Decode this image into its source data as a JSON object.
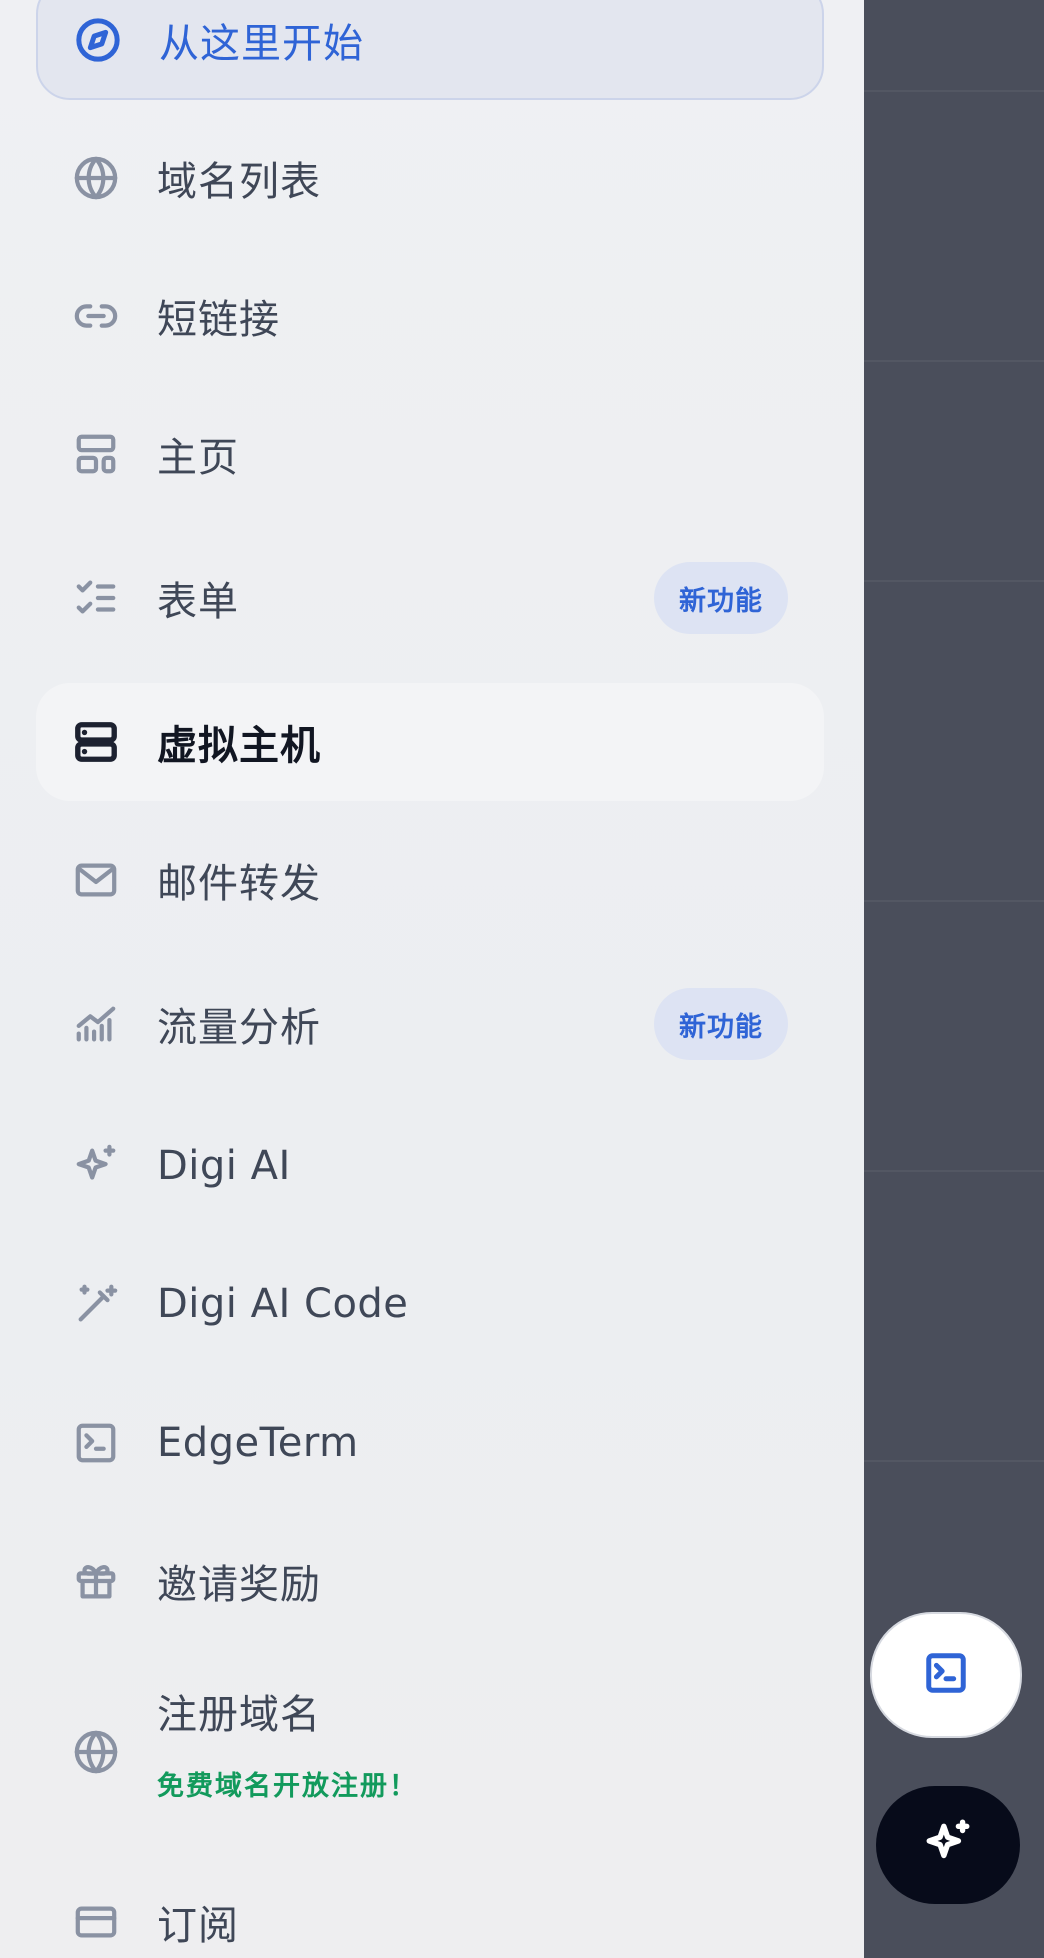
{
  "nav": {
    "start": {
      "label": "从这里开始",
      "icon": "compass-icon"
    },
    "domains": {
      "label": "域名列表",
      "icon": "globe-icon"
    },
    "short_links": {
      "label": "短链接",
      "icon": "link-icon"
    },
    "homepage": {
      "label": "主页",
      "icon": "layout-icon"
    },
    "forms": {
      "label": "表单",
      "icon": "list-checks-icon",
      "badge": "新功能"
    },
    "virtual_host": {
      "label": "虚拟主机",
      "icon": "server-icon"
    },
    "mail_forward": {
      "label": "邮件转发",
      "icon": "mail-icon"
    },
    "traffic": {
      "label": "流量分析",
      "icon": "chart-icon",
      "badge": "新功能"
    },
    "digi_ai": {
      "label": "Digi AI",
      "icon": "sparkle-icon"
    },
    "digi_ai_code": {
      "label": "Digi AI Code",
      "icon": "magic-wand-icon"
    },
    "edgeterm": {
      "label": "EdgeTerm",
      "icon": "terminal-icon"
    },
    "referral": {
      "label": "邀请奖励",
      "icon": "gift-icon"
    },
    "register_domain": {
      "label": "注册域名",
      "sublabel": "免费域名开放注册！",
      "icon": "globe-icon"
    },
    "subscription": {
      "label": "订阅",
      "icon": "credit-card-icon"
    }
  },
  "fabs": {
    "terminal": {
      "icon": "terminal-icon"
    },
    "ai": {
      "icon": "sparkle-icon"
    }
  },
  "colors": {
    "accent": "#2f64d6",
    "badge_bg": "#dde3f3",
    "success_text": "#129a5c",
    "overlay": "#4a4e5b",
    "fab_dark": "#070b1a"
  }
}
